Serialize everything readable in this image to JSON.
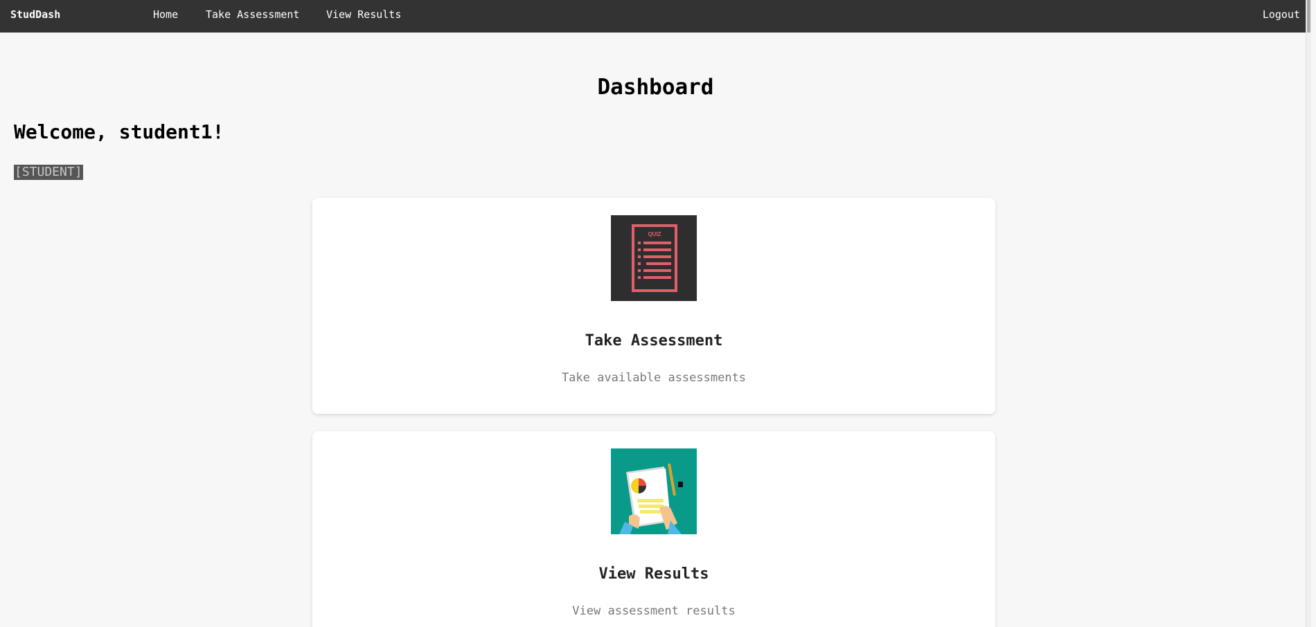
{
  "nav": {
    "brand": "StudDash",
    "links": [
      "Home",
      "Take Assessment",
      "View Results"
    ],
    "logout": "Logout"
  },
  "main": {
    "title": "Dashboard",
    "welcome": "Welcome, student1!",
    "role": "[STUDENT]"
  },
  "icons": {
    "quiz_text": "QUIZ"
  },
  "cards": [
    {
      "title": "Take Assessment",
      "description": "Take available assessments",
      "icon": "quiz-icon"
    },
    {
      "title": "View Results",
      "description": "View assessment results",
      "icon": "results-icon"
    }
  ],
  "colors": {
    "navbar": "#333333",
    "background": "#f7f7f7",
    "quiz_bg": "#2e2e2e",
    "quiz_accent": "#e0606a",
    "results_bg": "#0a9a8a"
  }
}
